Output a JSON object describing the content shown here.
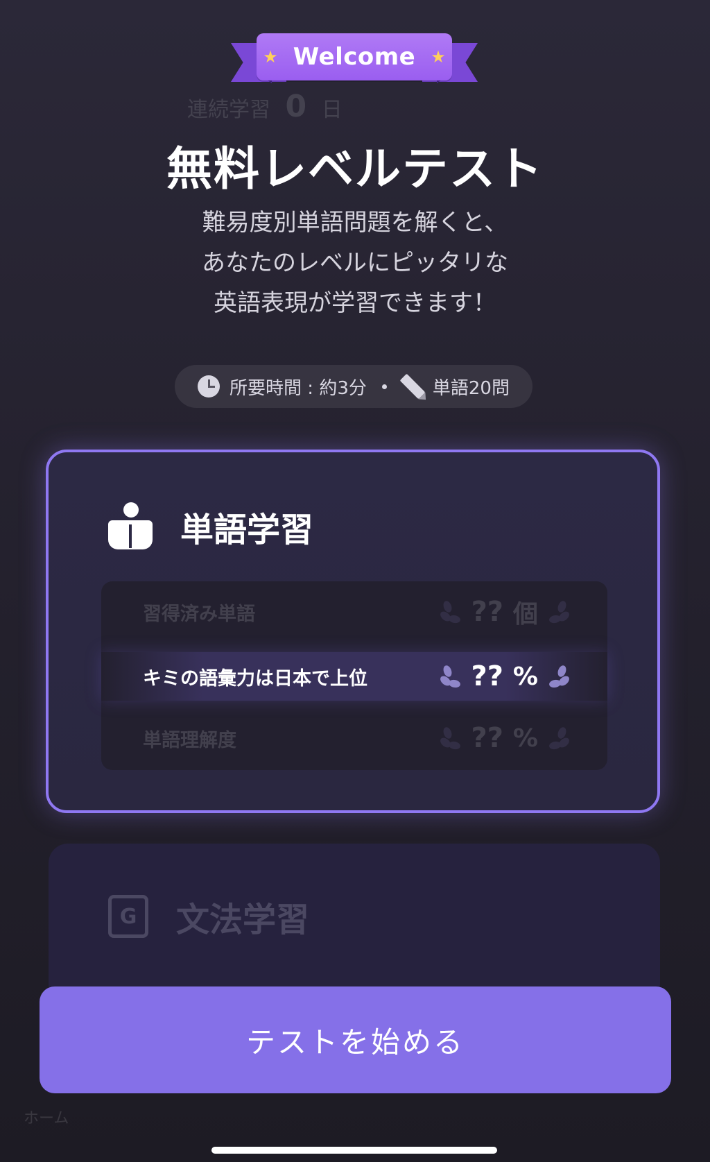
{
  "background": {
    "streak_label": "連続学習",
    "streak_value": "0",
    "streak_unit": "日",
    "nav_home": "ホーム"
  },
  "ribbon": {
    "text": "Welcome"
  },
  "header": {
    "title": "無料レベルテスト",
    "subtitle_lines": [
      "難易度別単語問題を解くと、",
      "あなたのレベルにピッタリな",
      "英語表現が学習できます！"
    ]
  },
  "info": {
    "duration": "所要時間 : 約3分",
    "questions": "単語20問"
  },
  "vocab_card": {
    "title": "単語学習",
    "rows": [
      {
        "label": "習得済み単語",
        "value": "??",
        "unit": "個"
      },
      {
        "label": "キミの語彙力は日本で上位",
        "value": "??",
        "unit": "%"
      },
      {
        "label": "単語理解度",
        "value": "??",
        "unit": "%"
      }
    ]
  },
  "grammar_card": {
    "title": "文法学習",
    "icon_letter": "G"
  },
  "start_button": {
    "label": "テストを始める"
  },
  "colors": {
    "accent": "#8570e8",
    "card_border": "#8f78f2",
    "ribbon": "#9a5ef0",
    "star": "#ffd05a"
  }
}
